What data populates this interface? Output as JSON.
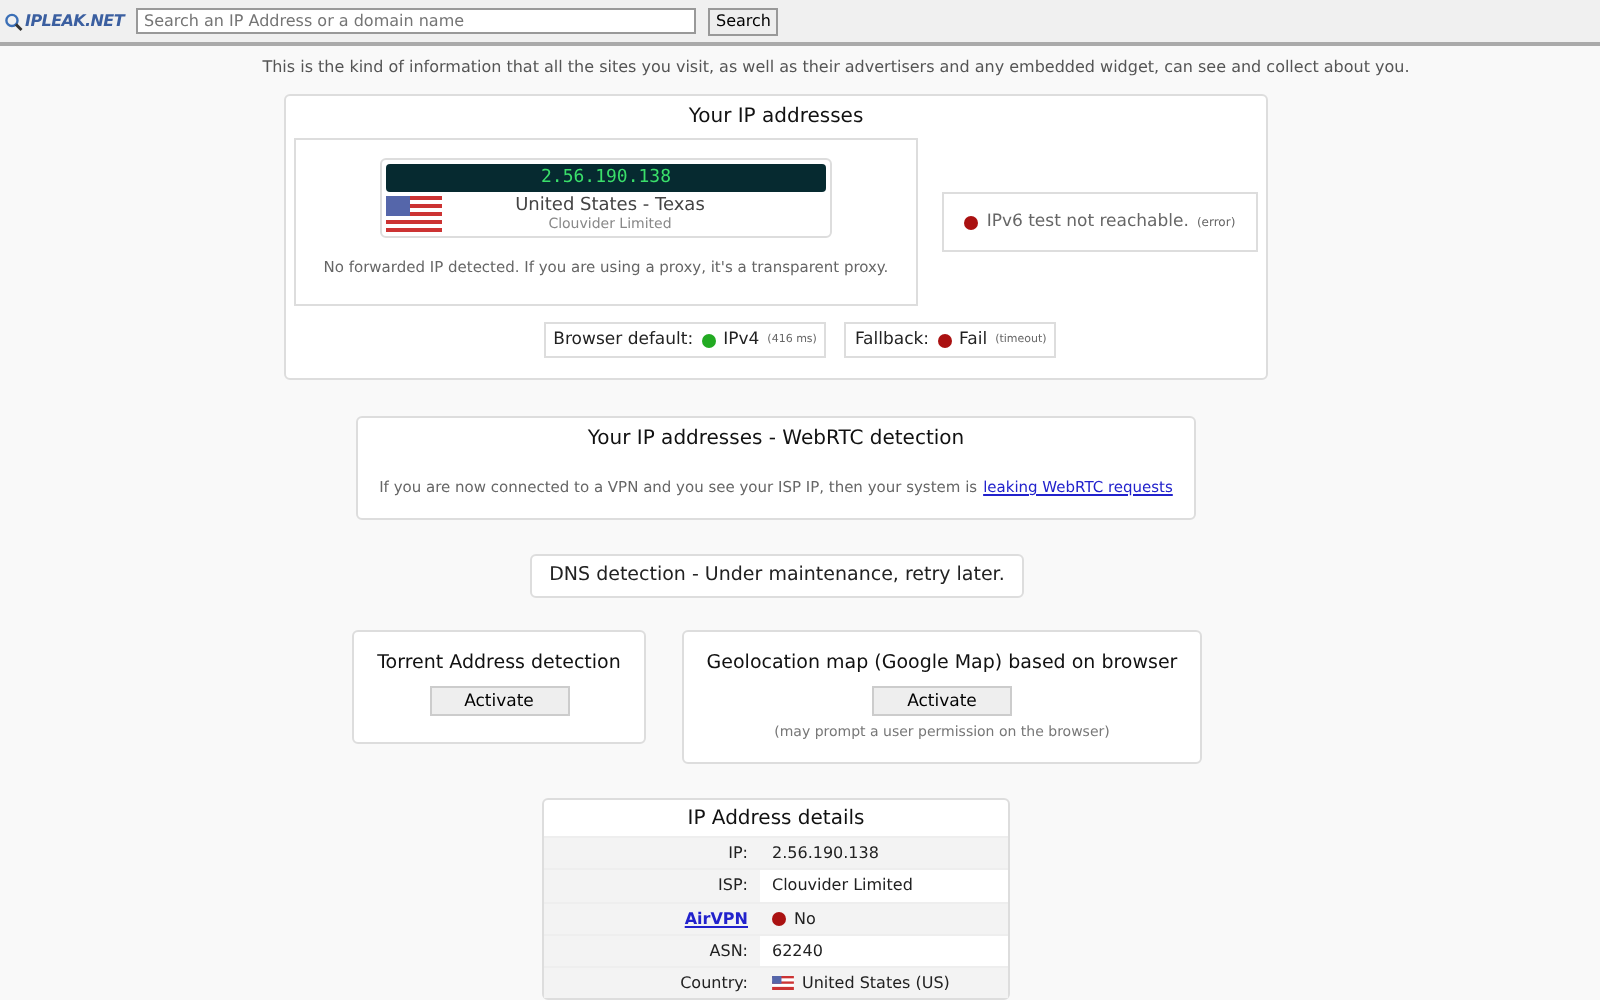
{
  "header": {
    "logo": "IPLEAK.NET",
    "search": {
      "placeholder": "Search an IP Address or a domain name"
    },
    "search_button": "Search"
  },
  "tagline": "This is the kind of information that all the sites you visit, as well as their advertisers and any embedded widget, can see and collect about you.",
  "ip_section": {
    "title": "Your IP addresses",
    "ip": "2.56.190.138",
    "location": "United States - Texas",
    "isp": "Clouvider Limited",
    "note": "No forwarded IP detected. If you are using a proxy, it's a transparent proxy.",
    "ipv6": {
      "text": "IPv6 test not reachable.",
      "detail": "(error)",
      "color": "#aa1111"
    },
    "checks": [
      {
        "label": "Browser default:",
        "value": "IPv4",
        "detail": "(416 ms)",
        "color": "#22aa22"
      },
      {
        "label": "Fallback:",
        "value": "Fail",
        "detail": "(timeout)",
        "color": "#aa1111"
      }
    ]
  },
  "webrtc": {
    "title": "Your IP addresses - WebRTC detection",
    "text": "If you are now connected to a VPN and you see your ISP IP, then your system is",
    "link": "leaking WebRTC requests"
  },
  "dns": {
    "text": "DNS detection - Under maintenance, retry later."
  },
  "tools": [
    {
      "title": "Torrent Address detection",
      "button": "Activate"
    },
    {
      "title": "Geolocation map (Google Map) based on browser",
      "button": "Activate",
      "note": "(may prompt a user permission on the browser)"
    }
  ],
  "details": {
    "title": "IP Address details",
    "rows": [
      {
        "label": "IP:",
        "value": "2.56.190.138",
        "kind": "text"
      },
      {
        "label": "ISP:",
        "value": "Clouvider Limited",
        "kind": "text"
      },
      {
        "label": "AirVPN",
        "value": "No",
        "kind": "link-dot",
        "color": "#aa1111"
      },
      {
        "label": "ASN:",
        "value": "62240",
        "kind": "text"
      },
      {
        "label": "Country:",
        "value": "United States (US)",
        "kind": "flag"
      }
    ]
  }
}
